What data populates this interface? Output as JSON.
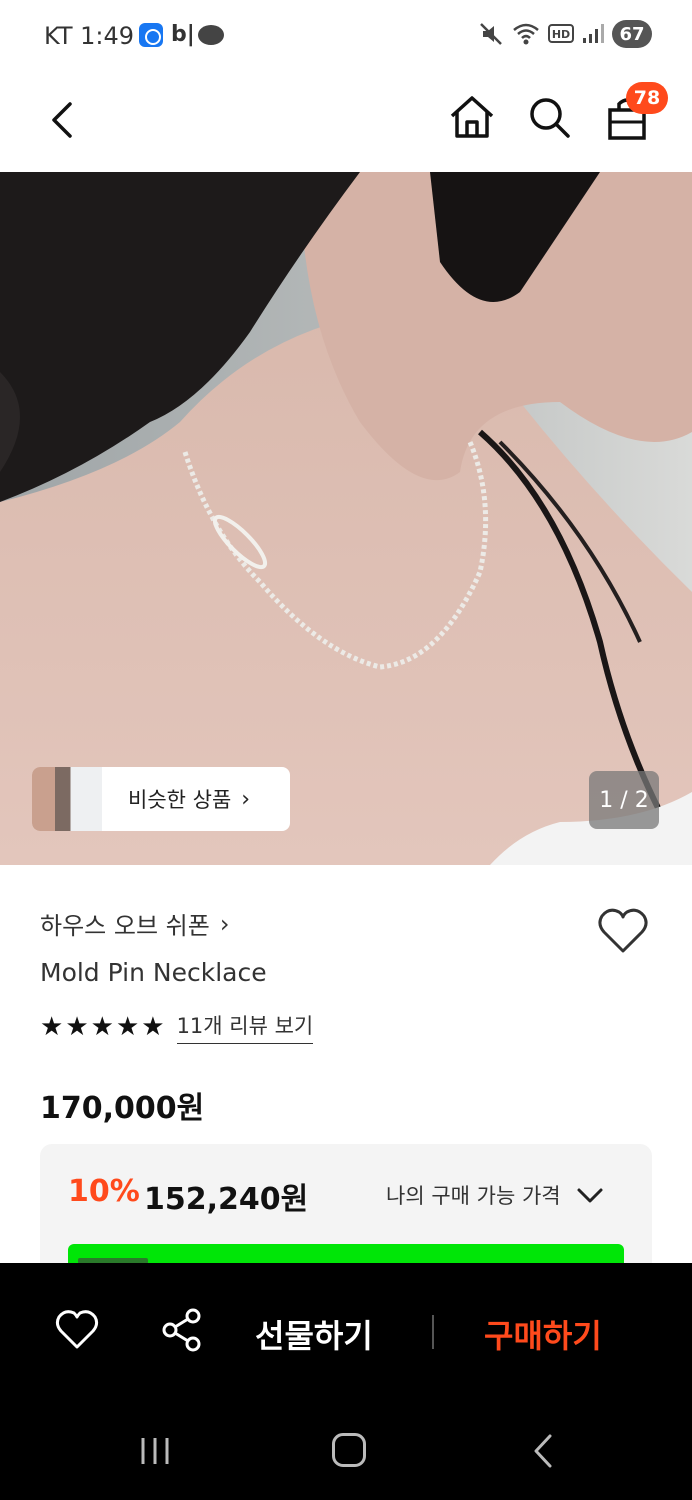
{
  "status_bar": {
    "time": "KT 1:49",
    "app_icon_b": "b|",
    "battery": "67"
  },
  "header": {
    "cart_count": "78",
    "icons": [
      "back-arrow-icon",
      "home-icon",
      "search-icon",
      "cart-bag-icon"
    ]
  },
  "image": {
    "similar_label": "비슷한 상품",
    "similar_chevron": "›",
    "page_indicator": "1 / 2"
  },
  "product": {
    "brand": "하우스 오브 쉬폰",
    "brand_chevron": "›",
    "name": "Mold Pin Necklace",
    "rating": 5,
    "review_link": "11개 리뷰 보기",
    "price": "170,000원"
  },
  "benefit": {
    "discount_rate": "10%",
    "discount_price": "152,240원",
    "my_price_label": "나의 구매 가능 가격"
  },
  "action_bar": {
    "gift_label": "선물하기",
    "buy_label": "구매하기"
  },
  "colors": {
    "accent": "#ff4a1c",
    "bar_bg": "#000000",
    "promo_green": "#00e607"
  }
}
